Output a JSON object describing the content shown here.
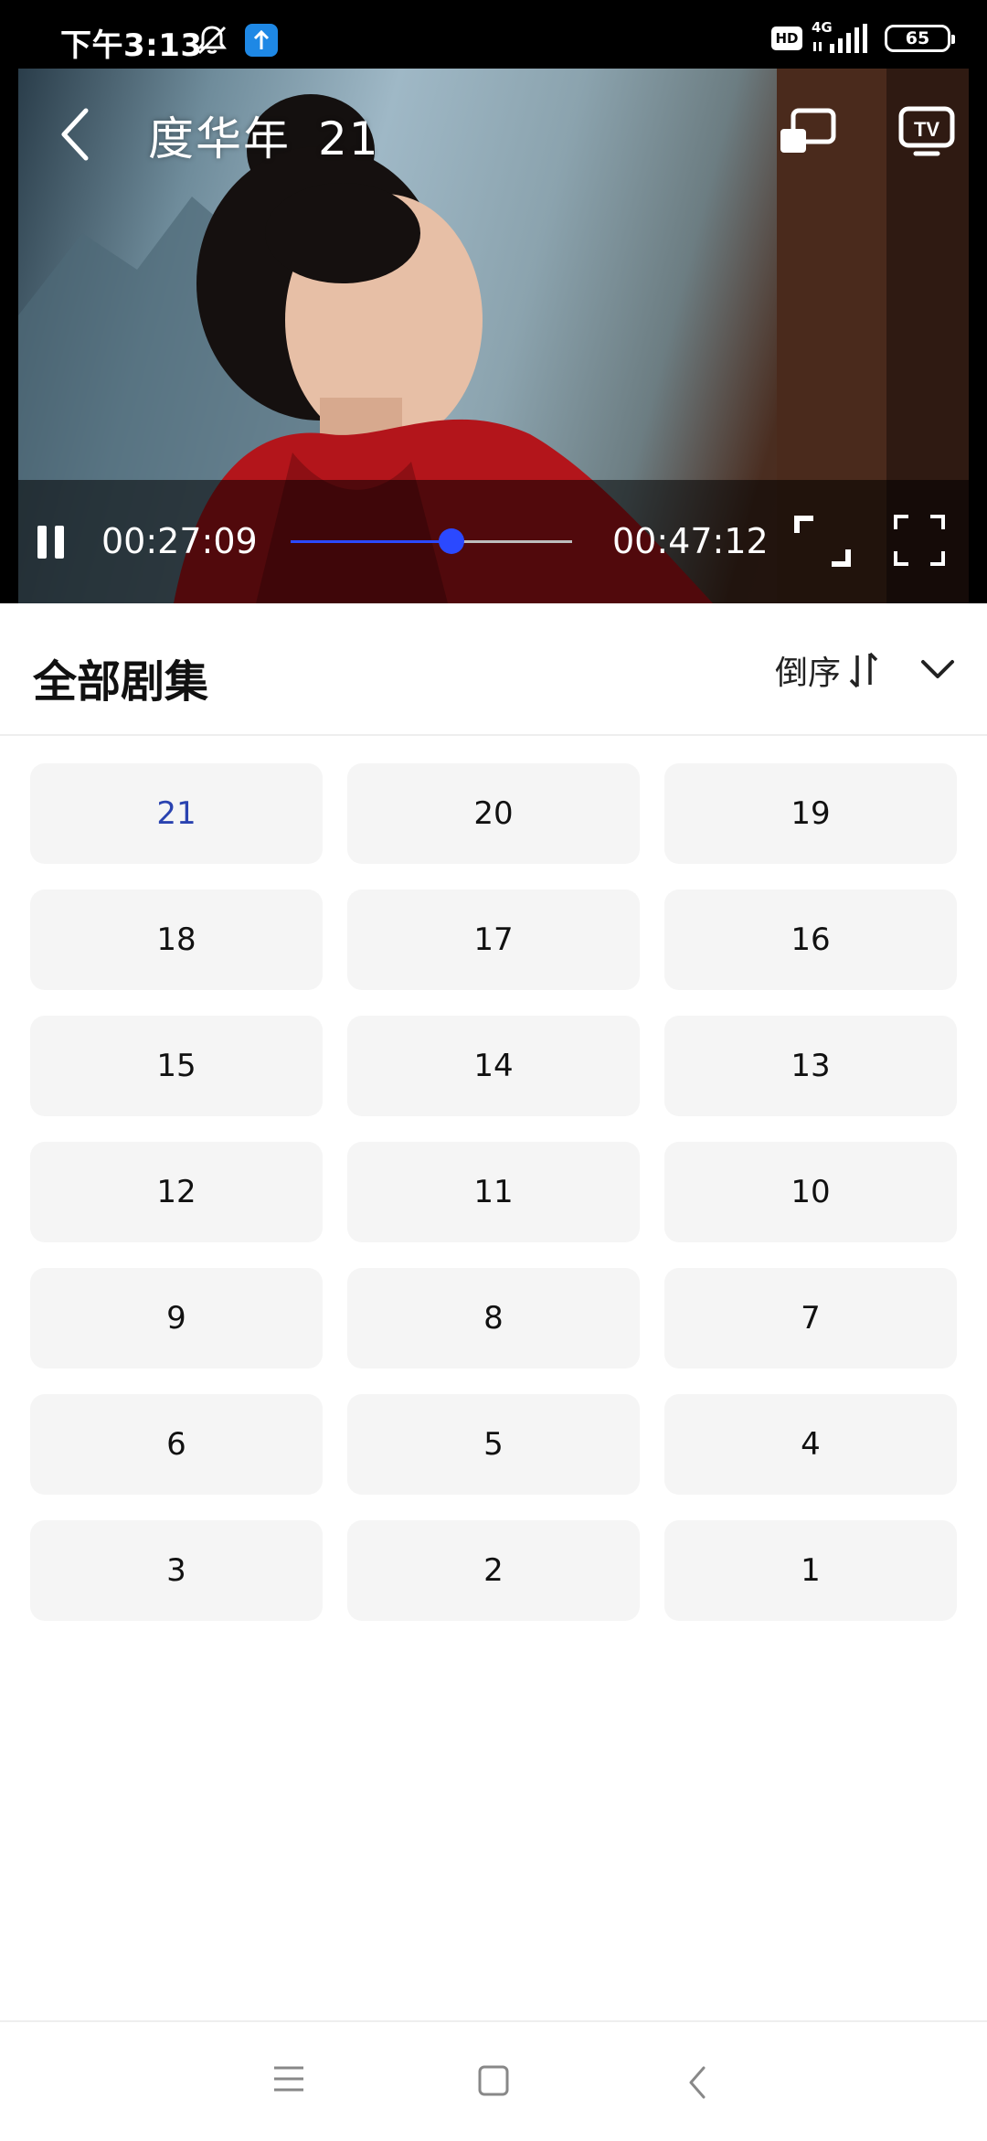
{
  "status_bar": {
    "time": "下午3:13",
    "hd_label": "HD",
    "network_label": "4G",
    "battery": "65",
    "icons": [
      "mute-icon",
      "upload-icon",
      "signal-icon",
      "battery-icon"
    ]
  },
  "player": {
    "show_title": "度华年",
    "episode": "21",
    "elapsed": "00:27:09",
    "duration": "00:47:12",
    "progress_fraction": 0.57,
    "accent_color": "#2b49ff",
    "icons": [
      "back-icon",
      "cast-icon",
      "tv-icon",
      "pause-icon",
      "fullscreen-enter-icon",
      "expand-icon"
    ]
  },
  "episodes_panel": {
    "title": "全部剧集",
    "sort_label": "倒序",
    "current_episode": "21",
    "current_color": "#2a43b0",
    "episodes": [
      "21",
      "20",
      "19",
      "18",
      "17",
      "16",
      "15",
      "14",
      "13",
      "12",
      "11",
      "10",
      "9",
      "8",
      "7",
      "6",
      "5",
      "4",
      "3",
      "2",
      "1"
    ]
  },
  "nav_bar": {
    "icons": [
      "menu-icon",
      "home-icon",
      "back-nav-icon"
    ]
  }
}
